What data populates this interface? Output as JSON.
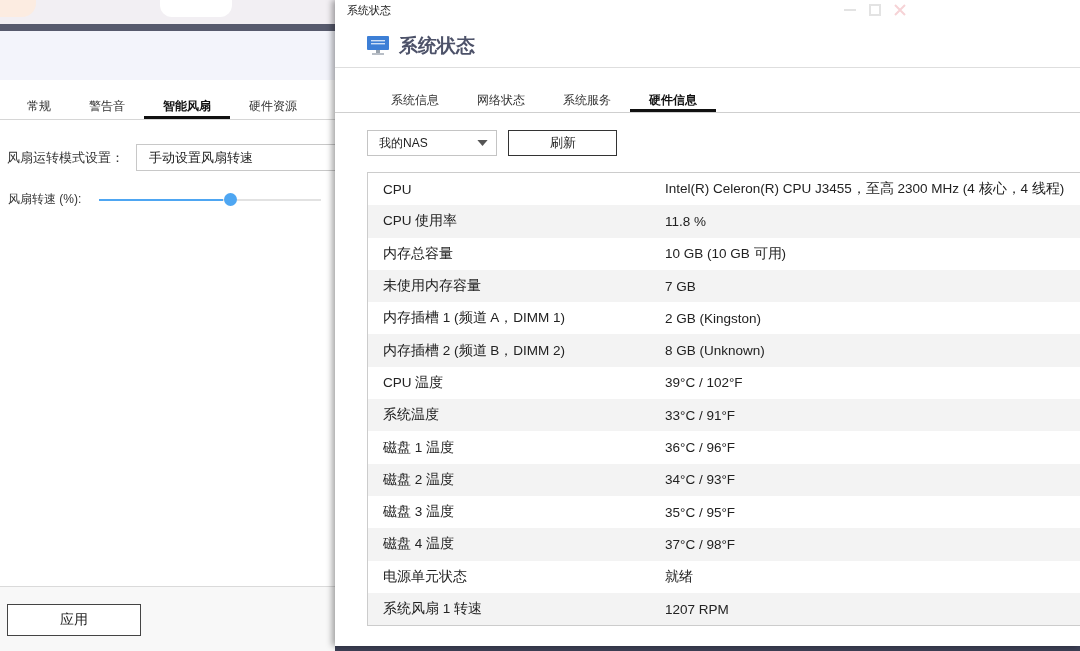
{
  "settings_window": {
    "tabs": [
      {
        "label": "常规",
        "selected": false
      },
      {
        "label": "警告音",
        "selected": false
      },
      {
        "label": "智能风扇",
        "selected": true
      },
      {
        "label": "硬件资源",
        "selected": false
      }
    ],
    "fan_mode": {
      "label": "风扇运转模式设置：",
      "value": "手动设置风扇转速"
    },
    "fan_speed": {
      "label": "风扇转速 (%):",
      "level": 0.59
    },
    "apply_button": "应用"
  },
  "status_window": {
    "window_title": "系统状态",
    "heading": "系统状态",
    "tabs": [
      {
        "label": "系统信息",
        "selected": false
      },
      {
        "label": "网络状态",
        "selected": false
      },
      {
        "label": "系统服务",
        "selected": false
      },
      {
        "label": "硬件信息",
        "selected": true
      }
    ],
    "device_select": {
      "value": "我的NAS"
    },
    "refresh_button": "刷新",
    "table": {
      "rows": [
        {
          "name": "CPU",
          "value": "Intel(R) Celeron(R) CPU J3455，至高 2300 MHz (4 核心，4 线程)"
        },
        {
          "name": "CPU 使用率",
          "value": "11.8 %"
        },
        {
          "name": "内存总容量",
          "value": "10 GB (10 GB 可用)"
        },
        {
          "name": "未使用内存容量",
          "value": "7 GB"
        },
        {
          "name": "内存插槽 1 (频道 A，DIMM 1)",
          "value": "2 GB (Kingston)"
        },
        {
          "name": "内存插槽 2 (频道 B，DIMM 2)",
          "value": "8 GB (Unknown)"
        },
        {
          "name": "CPU 温度",
          "value": "39°C / 102°F"
        },
        {
          "name": "系统温度",
          "value": "33°C / 91°F"
        },
        {
          "name": "磁盘 1 温度",
          "value": "36°C / 96°F"
        },
        {
          "name": "磁盘 2 温度",
          "value": "34°C / 93°F"
        },
        {
          "name": "磁盘 3 温度",
          "value": "35°C / 95°F"
        },
        {
          "name": "磁盘 4 温度",
          "value": "37°C / 98°F"
        },
        {
          "name": "电源单元状态",
          "value": "就绪"
        },
        {
          "name": "系统风扇 1 转速",
          "value": "1207 RPM"
        }
      ]
    }
  }
}
